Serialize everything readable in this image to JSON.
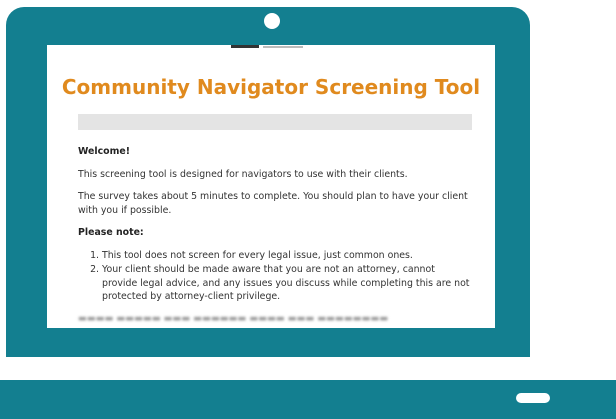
{
  "survey": {
    "title": "Community Navigator Screening Tool",
    "progress": 0,
    "welcome_heading": "Welcome!",
    "intro_line": "This screening tool is designed for navigators to use with their clients.",
    "duration_line": "The survey takes about 5 minutes to complete. You should plan to have your client with you if possible.",
    "note_heading": "Please note:",
    "notes": [
      "This tool does not screen for every legal issue, just common ones.",
      "Your client should be made aware that you are not an attorney, cannot provide legal advice, and any issues you discuss while completing this are not protected by attorney-client privilege."
    ]
  },
  "colors": {
    "device": "#137f90",
    "title": "#e08a1e",
    "progress_track": "#e4e4e4"
  },
  "icons": {
    "camera": "camera-icon",
    "power_light": "indicator-light-icon"
  }
}
